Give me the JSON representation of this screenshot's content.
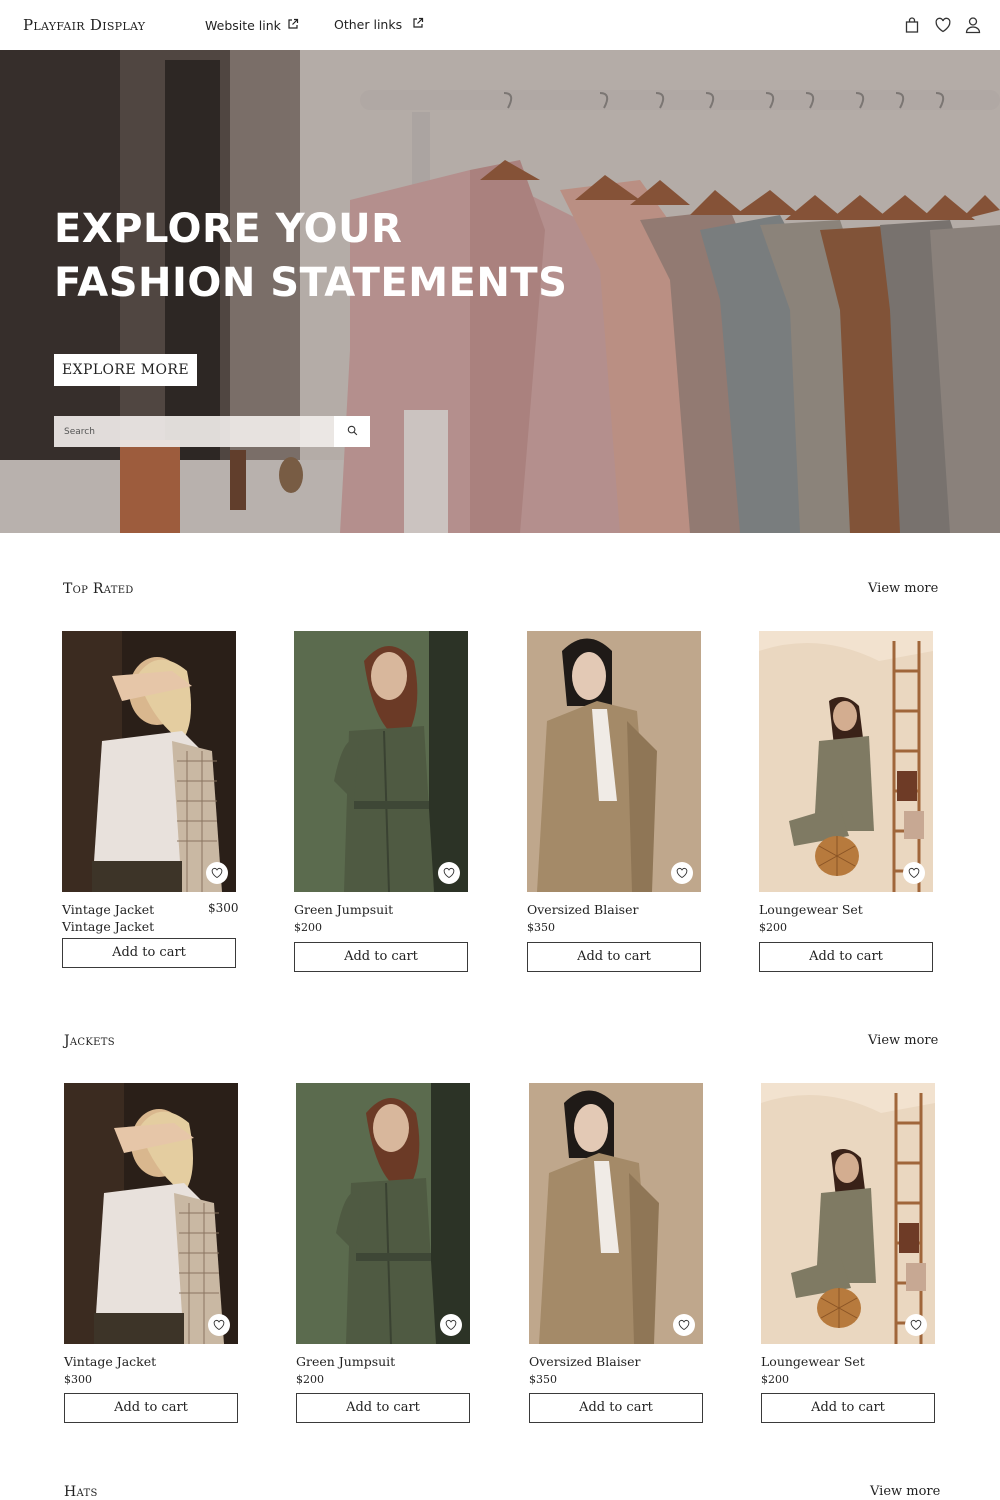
{
  "header": {
    "logo": "Playfair Display",
    "links": [
      {
        "label": "Website link",
        "icon": "external-link-icon"
      },
      {
        "label": "Other links",
        "icon": "external-link-icon"
      }
    ],
    "icons": [
      "shopping-bag-icon",
      "heart-icon",
      "user-icon"
    ]
  },
  "hero": {
    "title_line1": "EXPLORE YOUR",
    "title_line2": "FASHION STATEMENTS",
    "cta_label": "EXPLORE MORE",
    "search_placeholder": "Search",
    "search_icon": "search-icon"
  },
  "sections": [
    {
      "title": "Top Rated",
      "view_more": "View more",
      "products": [
        {
          "name": "Vintage Jacket Vintage Jacket",
          "price": "$300",
          "cart_label": "Add to cart",
          "photo": "vintage-jacket"
        },
        {
          "name": "Green Jumpsuit",
          "price": "$200",
          "cart_label": "Add to cart",
          "photo": "green-jumpsuit"
        },
        {
          "name": "Oversized Blaiser",
          "price": "$350",
          "cart_label": "Add to cart",
          "photo": "oversized-blazer"
        },
        {
          "name": "Loungewear Set",
          "price": "$200",
          "cart_label": "Add to cart",
          "photo": "loungewear-set"
        }
      ]
    },
    {
      "title": "Jackets",
      "view_more": "View more",
      "products": [
        {
          "name": "Vintage Jacket",
          "price": "$300",
          "cart_label": "Add to cart",
          "photo": "vintage-jacket"
        },
        {
          "name": "Green Jumpsuit",
          "price": "$200",
          "cart_label": "Add to cart",
          "photo": "green-jumpsuit"
        },
        {
          "name": "Oversized Blaiser",
          "price": "$350",
          "cart_label": "Add to cart",
          "photo": "oversized-blazer"
        },
        {
          "name": "Loungewear Set",
          "price": "$200",
          "cart_label": "Add to cart",
          "photo": "loungewear-set"
        }
      ]
    },
    {
      "title": "Hats",
      "view_more": "View more",
      "products": []
    }
  ],
  "colors": {
    "text": "#222222",
    "hero_white": "#ffffff",
    "border": "#3a3a3a"
  }
}
